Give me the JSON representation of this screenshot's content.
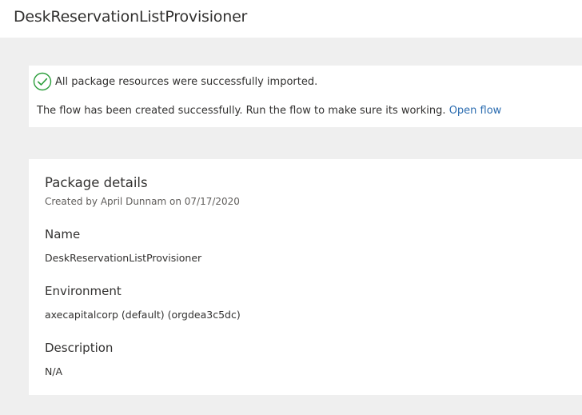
{
  "header": {
    "title": "DeskReservationListProvisioner"
  },
  "banner": {
    "success_icon": "check-circle-icon",
    "success_color": "#2a9d3a",
    "success_text": "All package resources were successfully imported.",
    "flow_message": "The flow has been created successfully. Run the flow to make sure its working.",
    "flow_link": "Open flow",
    "link_color": "#2b6cb0"
  },
  "details": {
    "title": "Package details",
    "created_by": "Created by April Dunnam on 07/17/2020",
    "fields": [
      {
        "label": "Name",
        "value": "DeskReservationListProvisioner"
      },
      {
        "label": "Environment",
        "value": "axecapitalcorp (default) (orgdea3c5dc)"
      },
      {
        "label": "Description",
        "value": "N/A"
      }
    ]
  }
}
